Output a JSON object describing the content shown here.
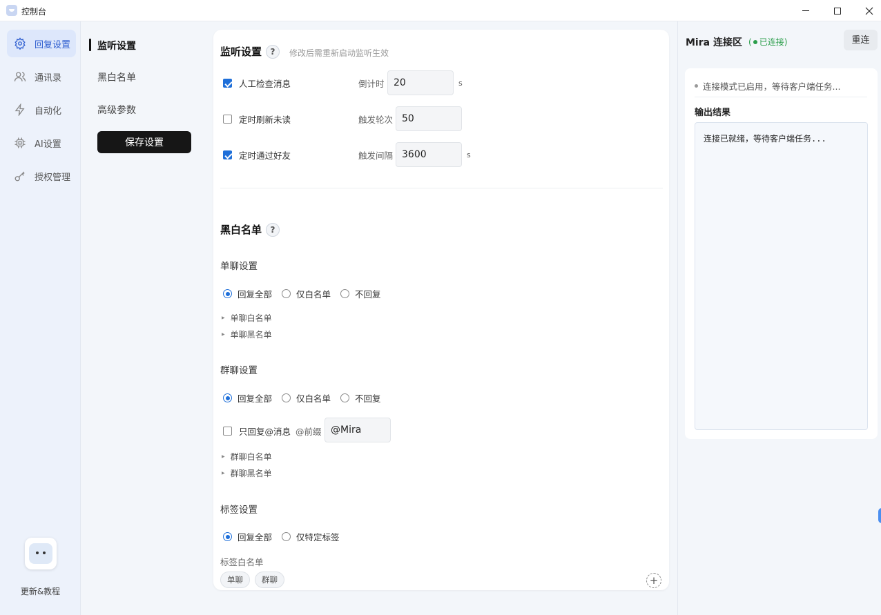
{
  "window": {
    "title": "控制台"
  },
  "nav": {
    "items": [
      {
        "label": "回复设置",
        "icon": "gear-icon",
        "active": true
      },
      {
        "label": "通讯录",
        "icon": "contacts-icon"
      },
      {
        "label": "自动化",
        "icon": "lightning-icon"
      },
      {
        "label": "AI设置",
        "icon": "chip-icon"
      },
      {
        "label": "授权管理",
        "icon": "key-icon"
      }
    ],
    "footer_label": "更新&教程"
  },
  "subnav": {
    "items": [
      "监听设置",
      "黑白名单",
      "高级参数"
    ],
    "save_label": "保存设置"
  },
  "listen": {
    "title": "监听设置",
    "help": "?",
    "hint": "修改后需重新启动监听生效",
    "rows": [
      {
        "label": "人工检查消息",
        "checked": true,
        "field_label": "倒计时",
        "value": "20",
        "unit": "s"
      },
      {
        "label": "定时刷新未读",
        "checked": false,
        "field_label": "触发轮次",
        "value": "50",
        "unit": ""
      },
      {
        "label": "定时通过好友",
        "checked": true,
        "field_label": "触发间隔",
        "value": "3600",
        "unit": "s"
      }
    ]
  },
  "lists": {
    "title": "黑白名单",
    "help": "?",
    "private": {
      "title": "单聊设置",
      "options": [
        "回复全部",
        "仅白名单",
        "不回复"
      ],
      "selected": "回复全部",
      "whitelist": "单聊白名单",
      "blacklist": "单聊黑名单"
    },
    "group": {
      "title": "群聊设置",
      "options": [
        "回复全部",
        "仅白名单",
        "不回复"
      ],
      "selected": "回复全部",
      "at_only_label": "只回复@消息",
      "at_only_checked": false,
      "prefix_label": "@前缀",
      "prefix_value": "@Mira",
      "whitelist": "群聊白名单",
      "blacklist": "群聊黑名单"
    },
    "tags": {
      "title": "标签设置",
      "options": [
        "回复全部",
        "仅特定标签"
      ],
      "selected": "回复全部",
      "whitelist_label": "标签白名单",
      "chips": [
        "单聊",
        "群聊"
      ],
      "add": "+"
    }
  },
  "side": {
    "title": "Mira 连接区",
    "status": "已连接",
    "status_color": "#2a9d4a",
    "reconnect_label": "重连",
    "mode_text": "连接模式已启用，等待客户端任务...",
    "output_label": "输出结果",
    "output_text": "连接已就绪，等待客户端任务..."
  },
  "colors": {
    "accent": "#1e6fd9",
    "save_button": "#161616"
  }
}
